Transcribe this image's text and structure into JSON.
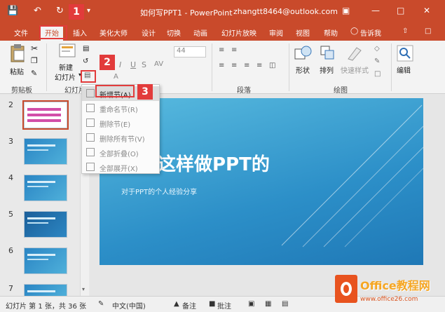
{
  "titlebar": {
    "document_title": "如何写PPT1 - PowerPoint",
    "account": "zhangtt8464@outlook.com"
  },
  "tabs": [
    {
      "label": "文件"
    },
    {
      "label": "开始"
    },
    {
      "label": "插入"
    },
    {
      "label": "美化大师"
    },
    {
      "label": "设计"
    },
    {
      "label": "切换"
    },
    {
      "label": "动画"
    },
    {
      "label": "幻灯片放映"
    },
    {
      "label": "审阅"
    },
    {
      "label": "视图"
    },
    {
      "label": "帮助"
    },
    {
      "label": "告诉我"
    }
  ],
  "ribbon": {
    "paste_label": "粘贴",
    "clipboard_group": "剪贴板",
    "new_slide_label_1": "新建",
    "new_slide_label_2": "幻灯片",
    "slides_group": "幻灯片",
    "font_size_value": "44",
    "paragraph_group": "段落",
    "shape_label": "形状",
    "arrange_label": "排列",
    "quick_style_label": "快速样式",
    "drawing_group": "绘图",
    "editing_label": "编辑"
  },
  "section_menu": {
    "items": [
      {
        "label": "新增节(A)",
        "enabled": true
      },
      {
        "label": "重命名节(R)",
        "enabled": false
      },
      {
        "label": "删除节(E)",
        "enabled": false
      },
      {
        "label": "删除所有节(V)",
        "enabled": false
      },
      {
        "label": "全部折叠(O)",
        "enabled": false
      },
      {
        "label": "全部展开(X)",
        "enabled": false
      }
    ]
  },
  "callouts": [
    "1",
    "2",
    "3"
  ],
  "thumbnails": {
    "numbers": [
      "2",
      "3",
      "4",
      "5",
      "6",
      "7"
    ]
  },
  "slide": {
    "title": "这样做PPT的",
    "subtitle": "对于PPT的个人经验分享"
  },
  "statusbar": {
    "slide_info": "幻灯片 第 1 张，共 36 张",
    "language": "中文(中国)",
    "notes": "备注",
    "comments": "批注"
  },
  "watermark": {
    "brand": "Office教程网",
    "url": "www.office26.com"
  },
  "colors": {
    "accent": "#c94a2b",
    "callout": "#e23b3b"
  }
}
